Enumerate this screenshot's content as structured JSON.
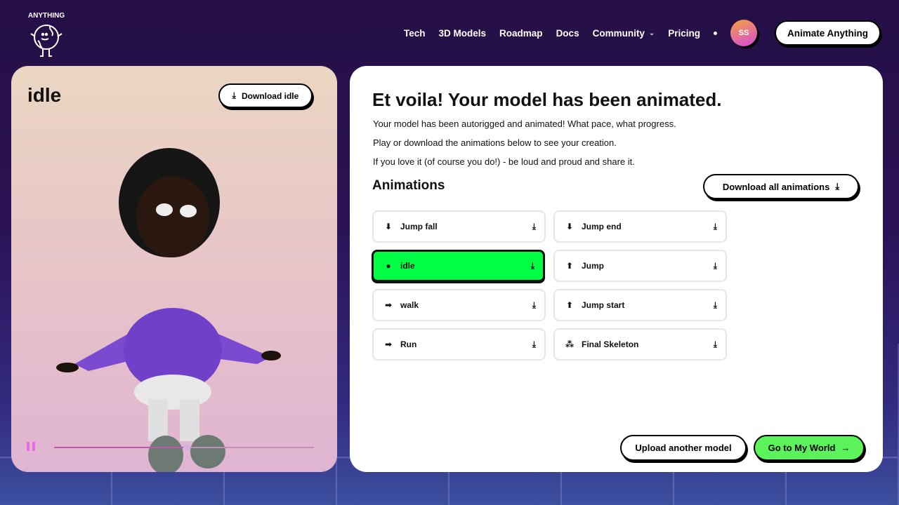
{
  "logo": {
    "text": "ANYTHING"
  },
  "nav": {
    "items": [
      "Tech",
      "3D Models",
      "Roadmap",
      "Docs",
      "Community",
      "Pricing"
    ],
    "avatar": "SS",
    "cta": "Animate Anything"
  },
  "preview": {
    "title": "idle",
    "download": "Download idle",
    "progress": 0.51,
    "state": "playing"
  },
  "main": {
    "title": "Et voila! Your model has been animated.",
    "lines": [
      "Your model has been autorigged and animated! What pace, what progress.",
      "Play or download the animations below to see your creation.",
      "If you love it (of course you do!) - be loud and proud and share it."
    ],
    "section": "Animations",
    "download_all": "Download all animations",
    "animations": [
      {
        "label": "Jump fall",
        "icon": "jump-fall-icon"
      },
      {
        "label": "Jump end",
        "icon": "jump-end-icon"
      },
      {
        "label": "idle",
        "icon": "location-pin-icon",
        "active": true
      },
      {
        "label": "Jump",
        "icon": "jump-icon"
      },
      {
        "label": "walk",
        "icon": "arrow-right-icon"
      },
      {
        "label": "Jump start",
        "icon": "jump-start-icon"
      },
      {
        "label": "Run",
        "icon": "run-arrow-icon"
      },
      {
        "label": "Final Skeleton",
        "icon": "skeleton-icon"
      }
    ],
    "upload": "Upload another model",
    "go": "Go to My World"
  },
  "colors": {
    "active": "#00ff44",
    "go": "#5cf25c",
    "accent": "#e86ce6"
  }
}
